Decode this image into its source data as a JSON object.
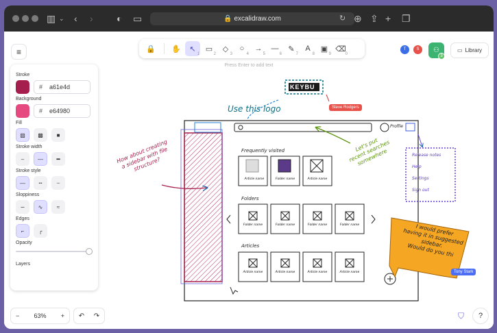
{
  "browser": {
    "url": "excalidraw.com",
    "lock_icon": "lock-icon"
  },
  "toolbar": {
    "tools": [
      {
        "name": "lock",
        "glyph": "🔒",
        "key": ""
      },
      {
        "name": "hand",
        "glyph": "✋",
        "key": ""
      },
      {
        "name": "selection",
        "glyph": "↖",
        "key": "1"
      },
      {
        "name": "rectangle",
        "glyph": "▭",
        "key": "2"
      },
      {
        "name": "diamond",
        "glyph": "◇",
        "key": "3"
      },
      {
        "name": "ellipse",
        "glyph": "○",
        "key": "4"
      },
      {
        "name": "arrow",
        "glyph": "→",
        "key": "5"
      },
      {
        "name": "line",
        "glyph": "—",
        "key": "6"
      },
      {
        "name": "draw",
        "glyph": "✎",
        "key": "7"
      },
      {
        "name": "text",
        "glyph": "A",
        "key": "8"
      },
      {
        "name": "image",
        "glyph": "▣",
        "key": "9"
      },
      {
        "name": "eraser",
        "glyph": "⌫",
        "key": "0"
      }
    ],
    "active_tool": "selection",
    "hint": "Press Enter to add text"
  },
  "top_right": {
    "avatars": [
      {
        "initial": "T",
        "color": "#3a6ee8"
      },
      {
        "initial": "S",
        "color": "#e8504a"
      }
    ],
    "collab_count": "3",
    "library_label": "Library"
  },
  "properties": {
    "stroke_label": "Stroke",
    "stroke_hash": "#",
    "stroke_hex": "a61e4d",
    "stroke_color": "#a61e4d",
    "background_label": "Background",
    "background_hash": "#",
    "background_hex": "e64980",
    "background_color": "#e64980",
    "fill_label": "Fill",
    "stroke_width_label": "Stroke width",
    "stroke_style_label": "Stroke style",
    "sloppiness_label": "Sloppiness",
    "edges_label": "Edges",
    "opacity_label": "Opacity",
    "opacity_value": 100,
    "layers_label": "Layers"
  },
  "footer": {
    "zoom_minus": "−",
    "zoom_level": "63%",
    "zoom_plus": "+",
    "undo": "↶",
    "redo": "↷"
  },
  "drawing": {
    "logo_text": "KEYBU",
    "use_logo_note": "Use this logo",
    "steve_tag": "Steve Rodgers",
    "sidebar_note_1": "How about creating",
    "sidebar_note_2": "a sidebar with file",
    "sidebar_note_3": "structure?",
    "search_note_1": "Let's put",
    "search_note_2": "recent searches",
    "search_note_3": "somewhere",
    "profile_label": "Profile",
    "menu_items": [
      "Release notes",
      "Help",
      "Settings",
      "Sign out"
    ],
    "frequently_visited": "Frequently visited",
    "fv_items": [
      "Article name",
      "Folder name",
      "Article name"
    ],
    "folders_label": "Folders",
    "folder_items": [
      "Folder name",
      "Folder name",
      "Folder name",
      "Folder name"
    ],
    "articles_label": "Articles",
    "article_items": [
      "Article name",
      "Article name",
      "Article name",
      "Article name"
    ],
    "sticky_1": "I would prefer",
    "sticky_2": "having it in suggested",
    "sticky_3": "sidebar.",
    "sticky_4": "Would do you thi",
    "tony_tag": "Tony Stark"
  }
}
